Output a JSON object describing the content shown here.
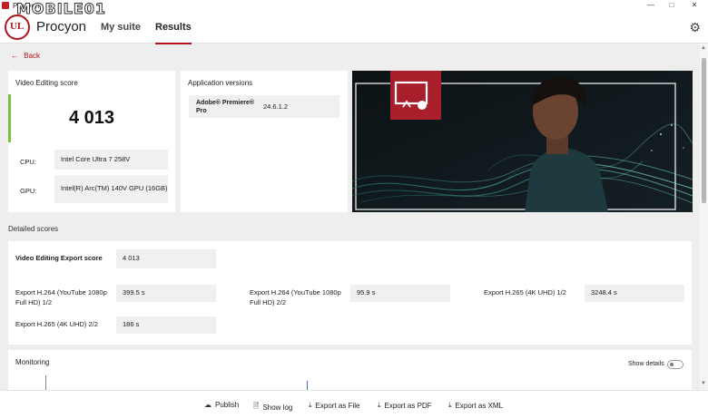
{
  "window": {
    "title": "Procyon"
  },
  "header": {
    "app_name": "Procyon",
    "tabs": [
      {
        "label": "My suite",
        "active": false
      },
      {
        "label": "Results",
        "active": true
      }
    ],
    "watermark": "MOBILE01"
  },
  "back_label": "Back",
  "score_card": {
    "title": "Video Editing score",
    "score": "4 013",
    "cpu_label": "CPU:",
    "cpu_value": "Intel Core Ultra 7 258V",
    "gpu_label": "GPU:",
    "gpu_value": "Intel(R) Arc(TM) 140V GPU (16GB)"
  },
  "app_versions": {
    "title": "Application versions",
    "app_name": "Adobe® Premiere® Pro",
    "version": "24.6.1.2"
  },
  "detailed": {
    "section_title": "Detailed scores",
    "export_score_label": "Video Editing Export score",
    "export_score_value": "4 013",
    "items": [
      {
        "label": "Export H.264 (YouTube 1080p Full HD) 1/2",
        "value": "399.5 s"
      },
      {
        "label": "Export H.264 (YouTube 1080p Full HD) 2/2",
        "value": "95.9 s"
      },
      {
        "label": "Export H.265 (4K UHD) 1/2",
        "value": "3248.4 s"
      },
      {
        "label": "Export H.265 (4K UHD) 2/2",
        "value": "186 s"
      }
    ]
  },
  "monitoring": {
    "title": "Monitoring",
    "show_details_label": "Show details",
    "show_details_on": false
  },
  "actions": {
    "publish": "Publish",
    "show_log": "Show log",
    "export_file": "Export as File",
    "export_pdf": "Export as PDF",
    "export_xml": "Export as XML"
  },
  "colors": {
    "accent": "#b3141e",
    "score_bar": "#79c040"
  }
}
